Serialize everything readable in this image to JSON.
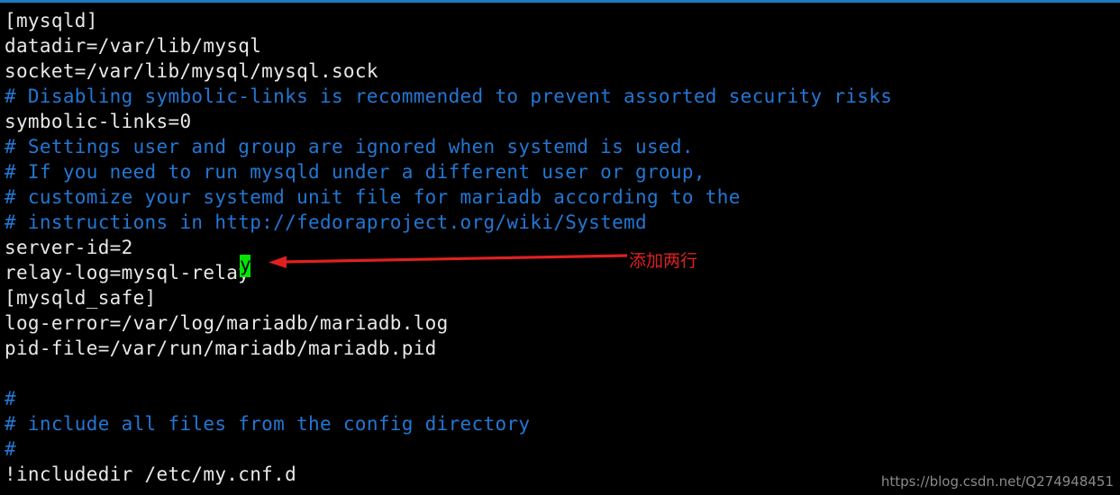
{
  "window": {
    "kind": "terminal-text-editor",
    "background_color": "#000000",
    "top_rule_color": "#1b7bc4",
    "foreground_color": "#e8e8e8",
    "comment_color": "#2277d4",
    "cursor_color": "#00e500",
    "annotation_color": "#e02020"
  },
  "editor": {
    "lines": [
      {
        "text": "[mysqld]",
        "color": "white"
      },
      {
        "text": "datadir=/var/lib/mysql",
        "color": "white"
      },
      {
        "text": "socket=/var/lib/mysql/mysql.sock",
        "color": "white"
      },
      {
        "text": "# Disabling symbolic-links is recommended to prevent assorted security risks",
        "color": "blue"
      },
      {
        "text": "symbolic-links=0",
        "color": "white"
      },
      {
        "text": "# Settings user and group are ignored when systemd is used.",
        "color": "blue"
      },
      {
        "text": "# If you need to run mysqld under a different user or group,",
        "color": "blue"
      },
      {
        "text": "# customize your systemd unit file for mariadb according to the",
        "color": "blue"
      },
      {
        "text": "# instructions in http://fedoraproject.org/wiki/Systemd",
        "color": "blue"
      },
      {
        "text": "server-id=2",
        "color": "white"
      },
      {
        "text": "relay-log=mysql-relay",
        "color": "white"
      },
      {
        "text": "[mysqld_safe]",
        "color": "white"
      },
      {
        "text": "log-error=/var/log/mariadb/mariadb.log",
        "color": "white"
      },
      {
        "text": "pid-file=/var/run/mariadb/mariadb.pid",
        "color": "white"
      },
      {
        "text": "",
        "color": "white"
      },
      {
        "text": "#",
        "color": "blue"
      },
      {
        "text": "# include all files from the config directory",
        "color": "blue"
      },
      {
        "text": "#",
        "color": "blue"
      },
      {
        "text": "!includedir /etc/my.cnf.d",
        "color": "white"
      }
    ]
  },
  "cursor": {
    "character": "y",
    "on_line_index": 10,
    "column": 21
  },
  "annotation": {
    "label": "添加两行",
    "arrow_direction": "left"
  },
  "watermark": {
    "text": "https://blog.csdn.net/Q274948451"
  }
}
